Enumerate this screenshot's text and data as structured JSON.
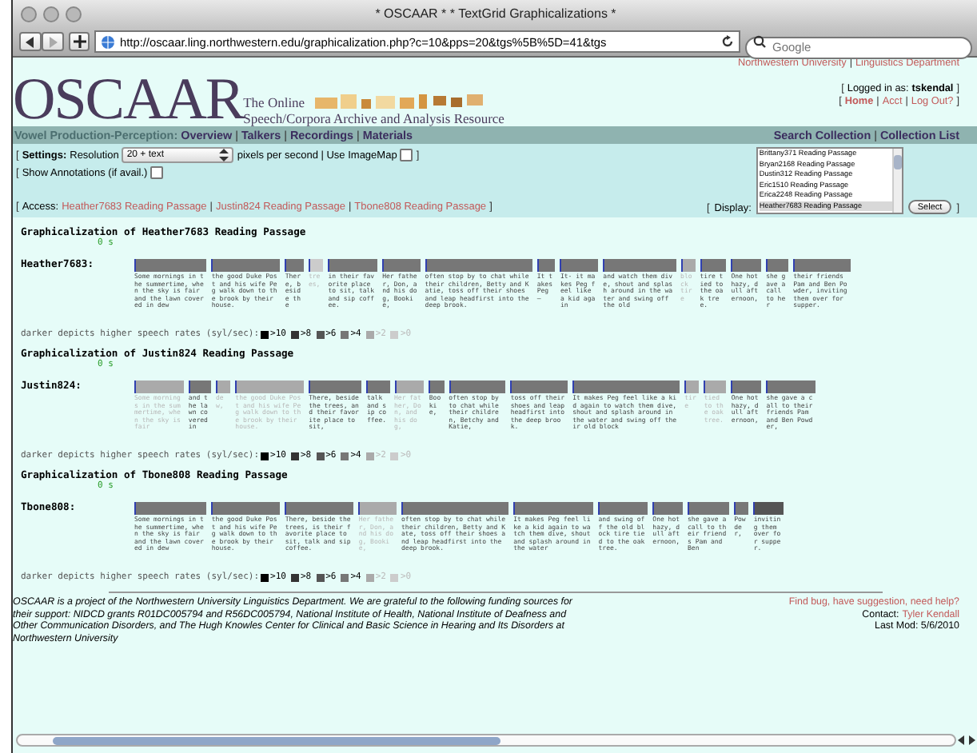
{
  "window": {
    "title": "* OSCAAR * * TextGrid Graphicalizations *"
  },
  "toolbar": {
    "url": "http://oscaar.ling.northwestern.edu/graphicalization.php?c=10&pps=20&tgs%5B%5D=41&tgs",
    "search_placeholder": "Google"
  },
  "header": {
    "affiliation": [
      {
        "kind": "link",
        "label": "Northwestern University"
      },
      {
        "kind": "sep",
        "label": "|"
      },
      {
        "kind": "link",
        "label": "Linguistics Department"
      }
    ],
    "logo": "OSCAAR",
    "tagline_1": "The Online",
    "tagline_2": "Speech/Corpora Archive and Analysis Resource",
    "login": [
      {
        "kind": "bracket",
        "label": "["
      },
      {
        "kind": "text",
        "label": "Logged in as:"
      },
      {
        "kind": "bold",
        "label": "tskendal"
      },
      {
        "kind": "bracket",
        "label": "]"
      }
    ],
    "account_links": [
      {
        "kind": "bracket",
        "label": "["
      },
      {
        "kind": "bold_link",
        "label": "Home"
      },
      {
        "kind": "sep",
        "label": "|"
      },
      {
        "kind": "link",
        "label": "Acct"
      },
      {
        "kind": "sep",
        "label": "|"
      },
      {
        "kind": "link",
        "label": "Log Out?"
      },
      {
        "kind": "bracket",
        "label": "]"
      }
    ]
  },
  "nav": {
    "left": [
      {
        "kind": "collection",
        "label": "Vowel Production-Perception:"
      },
      {
        "kind": "nav_link",
        "label": "Overview"
      },
      {
        "kind": "sep",
        "label": "|"
      },
      {
        "kind": "nav_link",
        "label": "Talkers"
      },
      {
        "kind": "sep",
        "label": "|"
      },
      {
        "kind": "nav_link",
        "label": "Recordings"
      },
      {
        "kind": "sep",
        "label": "|"
      },
      {
        "kind": "nav_link",
        "label": "Materials"
      }
    ],
    "right": [
      {
        "kind": "nav_link",
        "label": "Search Collection"
      },
      {
        "kind": "sep",
        "label": "|"
      },
      {
        "kind": "nav_link",
        "label": "Collection List"
      }
    ]
  },
  "settings": {
    "rows": [
      {
        "parts": [
          {
            "kind": "bracket",
            "label": "["
          },
          {
            "kind": "bold",
            "label": "Settings:"
          },
          {
            "kind": "text",
            "label": "Resolution"
          },
          {
            "kind": "dropdown",
            "label": "20 + text"
          },
          {
            "kind": "text",
            "label": "pixels per second | Use ImageMap"
          },
          {
            "kind": "checkbox",
            "checked": false
          },
          {
            "kind": "bracket",
            "label": "]"
          }
        ]
      },
      {
        "parts": [
          {
            "kind": "bracket",
            "label": "["
          },
          {
            "kind": "text",
            "label": "Show Annotations (if avail.)"
          },
          {
            "kind": "checkbox",
            "checked": false
          }
        ]
      },
      {
        "parts": [
          {
            "kind": "bracket",
            "label": "["
          },
          {
            "kind": "text",
            "label": "Access:"
          },
          {
            "kind": "link",
            "label": "Heather7683 Reading Passage"
          },
          {
            "kind": "sep",
            "label": "|"
          },
          {
            "kind": "link",
            "label": "Justin824 Reading Passage"
          },
          {
            "kind": "sep",
            "label": "|"
          },
          {
            "kind": "link",
            "label": "Tbone808 Reading Passage"
          },
          {
            "kind": "bracket",
            "label": "]"
          }
        ]
      }
    ],
    "display_open": "[",
    "display_label": "Display:",
    "display_options": [
      {
        "label": "Brittany371 Reading Passage",
        "selected": false
      },
      {
        "label": "Bryan2168 Reading Passage",
        "selected": false
      },
      {
        "label": "Dustin312 Reading Passage",
        "selected": false
      },
      {
        "label": "Eric1510 Reading Passage",
        "selected": false
      },
      {
        "label": "Erica2248 Reading Passage",
        "selected": false
      },
      {
        "label": "Heather7683 Reading Passage",
        "selected": true
      }
    ],
    "select_button": "Select",
    "display_close": "]"
  },
  "sections": [
    {
      "title": "Graphicalization of Heather7683 Reading Passage",
      "time": "0 s",
      "speaker": "Heather7683:",
      "segments": [
        {
          "text": "Some mornings in the summertime, when the sky is fair and the lawn covered in dew",
          "color": "#777777"
        },
        {
          "text": "the good Duke Post and his wife Peg walk down to the brook by their house.",
          "color": "#777777"
        },
        {
          "text": "There, beside the",
          "color": "#777777"
        },
        {
          "text": "trees,",
          "color": "#cccccc"
        },
        {
          "text": "in their favorite place to sit, talk and sip coffee.",
          "color": "#777777"
        },
        {
          "text": "Her father, Don, and his dog, Bookie,",
          "color": "#777777"
        },
        {
          "text": "often stop by to chat while their children, Betty and Katie, toss off their shoes and leap headfirst into the deep brook.",
          "color": "#777777"
        },
        {
          "text": "It takes Peg —",
          "color": "#777777"
        },
        {
          "text": "It- it makes Peg feel like a kid again",
          "color": "#777777"
        },
        {
          "text": "and watch them dive, shout and splash around in the water and swing off the old",
          "color": "#777777"
        },
        {
          "text": "block tire",
          "color": "#aaaaaa"
        },
        {
          "text": "tire tied to the oak tree.",
          "color": "#777777"
        },
        {
          "text": "One hot hazy, dull afternoon,",
          "color": "#777777"
        },
        {
          "text": "she gave a call to her",
          "color": "#777777"
        },
        {
          "text": "their friends Pam and Ben Powder, inviting them over for supper.",
          "color": "#777777"
        }
      ],
      "legend": {
        "caption": "darker depicts higher speech rates (syl/sec):",
        "steps": [
          {
            "label": ">10",
            "color": "#000000"
          },
          {
            "label": ">8",
            "color": "#333333"
          },
          {
            "label": ">6",
            "color": "#555555"
          },
          {
            "label": ">4",
            "color": "#777777"
          },
          {
            "label": ">2",
            "color": "#aaaaaa"
          },
          {
            "label": ">0",
            "color": "#cccccc"
          }
        ]
      }
    },
    {
      "title": "Graphicalization of Justin824 Reading Passage",
      "time": "0 s",
      "speaker": "Justin824:",
      "segments": [
        {
          "text": "Some mornings in the summertime, when the sky is fair",
          "color": "#aaaaaa"
        },
        {
          "text": "and the lawn covered in",
          "color": "#777777"
        },
        {
          "text": "dew,",
          "color": "#aaaaaa"
        },
        {
          "text": "the good Duke Post and his wife Peg walk down to the brook by their house.",
          "color": "#aaaaaa"
        },
        {
          "text": "There, beside the trees, and their favorite place to sit,",
          "color": "#777777"
        },
        {
          "text": "talk and sip coffee.",
          "color": "#777777"
        },
        {
          "text": "Her father, Don, and his dog,",
          "color": "#aaaaaa"
        },
        {
          "text": "Bookie,",
          "color": "#777777"
        },
        {
          "text": "often stop by to chat while their children, Betchy and Katie,",
          "color": "#777777"
        },
        {
          "text": "toss off their shoes and leap headfirst into the deep brook.",
          "color": "#777777"
        },
        {
          "text": "It makes Peg feel like a kid again to watch them dive, shout and splash around in the water and swing off their old block",
          "color": "#777777"
        },
        {
          "text": "tire",
          "color": "#aaaaaa"
        },
        {
          "text": "tied to the oak tree.",
          "color": "#aaaaaa"
        },
        {
          "text": "One hot hazy, dull afternoon,",
          "color": "#777777"
        },
        {
          "text": "she gave a call to their friends Pam and Ben Powder,",
          "color": "#777777"
        }
      ],
      "legend": {
        "caption": "darker depicts higher speech rates (syl/sec):",
        "steps": [
          {
            "label": ">10",
            "color": "#000000"
          },
          {
            "label": ">8",
            "color": "#333333"
          },
          {
            "label": ">6",
            "color": "#555555"
          },
          {
            "label": ">4",
            "color": "#777777"
          },
          {
            "label": ">2",
            "color": "#aaaaaa"
          },
          {
            "label": ">0",
            "color": "#cccccc"
          }
        ]
      }
    },
    {
      "title": "Graphicalization of Tbone808 Reading Passage",
      "time": "0 s",
      "speaker": "Tbone808:",
      "segments": [
        {
          "text": "Some mornings in the summertime, when the sky is fair and the lawn covered in dew",
          "color": "#777777"
        },
        {
          "text": "the good Duke Post and his wife Peg walk down to the brook by their house.",
          "color": "#777777"
        },
        {
          "text": "There, beside the trees, is their favorite place to sit, talk and sip coffee.",
          "color": "#777777"
        },
        {
          "text": "Her father, Don, and his dog, Bookie,",
          "color": "#aaaaaa"
        },
        {
          "text": "often stop by to chat while their children, Betty and Kate, toss off their shoes and leap headfirst into the deep brook.",
          "color": "#777777"
        },
        {
          "text": "It makes Peg feel like a kid again to watch them dive, shout and splash around in the water",
          "color": "#777777"
        },
        {
          "text": "and swing off the old block tire tied to the oak tree.",
          "color": "#777777"
        },
        {
          "text": "One hot hazy, dull afternoon,",
          "color": "#777777"
        },
        {
          "text": "she gave a call to their friends Pam and Ben",
          "color": "#777777"
        },
        {
          "text": "Powder,",
          "color": "#777777"
        },
        {
          "text": "inviting them over for supper.",
          "color": "#555555"
        }
      ],
      "legend": {
        "caption": "darker depicts higher speech rates (syl/sec):",
        "steps": [
          {
            "label": ">10",
            "color": "#000000"
          },
          {
            "label": ">8",
            "color": "#333333"
          },
          {
            "label": ">6",
            "color": "#555555"
          },
          {
            "label": ">4",
            "color": "#777777"
          },
          {
            "label": ">2",
            "color": "#aaaaaa"
          },
          {
            "label": ">0",
            "color": "#cccccc"
          }
        ]
      }
    }
  ],
  "footer": {
    "acknowledgement": "OSCAAR is a project of the Northwestern University Linguistics Department. We are grateful to the following funding sources for their support: NIDCD grants R01DC005794 and R56DC005794, National Institute of Health, National Institute of Deafness and Other Communication Disorders, and The Hugh Knowles Center for Clinical and Basic Science in Hearing and Its Disorders at Northwestern University",
    "help_link": "Find bug, have suggestion, need help?",
    "contact_label": "Contact:",
    "contact": "Tyler Kendall",
    "last_mod": "Last Mod: 5/6/2010"
  }
}
